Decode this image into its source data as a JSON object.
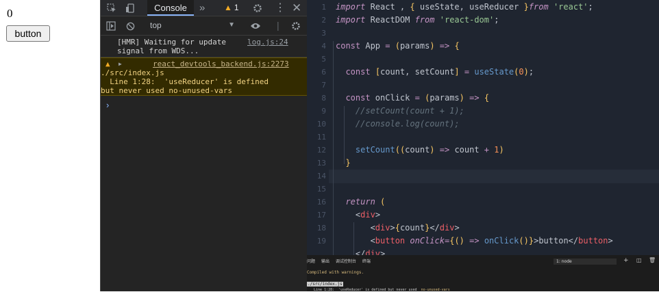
{
  "app": {
    "count": "0",
    "button_label": "button"
  },
  "devtools": {
    "tab": "Console",
    "more_tabs": "»",
    "warning_count": "1",
    "context": "top",
    "messages": {
      "hmr_text": "[HMR] Waiting for update signal from WDS...",
      "hmr_source": "log.js:24",
      "warn_source": "react_devtools_backend.js:2273",
      "warn_line1": "./src/index.js",
      "warn_line2": "  Line 1:28:  'useReducer' is defined",
      "warn_line3": "but never used  no-unused-vars"
    },
    "icons": [
      "inspect-icon",
      "device-toggle-icon",
      "warning-icon",
      "gear-icon",
      "kebab-menu-icon",
      "close-icon",
      "sidebar-toggle-icon",
      "clear-console-icon",
      "eye-icon",
      "gear-icon"
    ]
  },
  "editor": {
    "line_numbers": [
      "1",
      "2",
      "3",
      "4",
      "5",
      "6",
      "7",
      "8",
      "9",
      "10",
      "11",
      "12",
      "13",
      "14",
      "15",
      "16",
      "17",
      "18",
      "19"
    ],
    "lines": [
      "import React , { useState, useReducer }from 'react';",
      "import ReactDOM from 'react-dom';",
      "",
      "const App = (params) => {",
      "",
      "  const [count, setCount] = useState(0);",
      "",
      "  const onClick = (params) => {",
      "    //setCount(count + 1);",
      "    //console.log(count);",
      "",
      "    setCount((count) => count + 1)",
      "  }",
      "",
      "",
      "  return (",
      "    <div>",
      "       <div>{count}</div>",
      "       <button onClick={() => onClick()}>button</button>",
      "    </div>"
    ]
  },
  "terminal": {
    "tabs": [
      "问题",
      "输出",
      "调试控制台",
      "终端"
    ],
    "shell": "1: node",
    "line1": "Compiled with warnings.",
    "line2": "./src/index.js",
    "line3_a": "  Line 1:28:  'useReducer' is defined but never used  ",
    "line3_b": "no-unused-vars"
  },
  "colors": {
    "accent": "#8ab4f8",
    "warning": "#f2ab26",
    "editor_bg": "#1f2530"
  }
}
